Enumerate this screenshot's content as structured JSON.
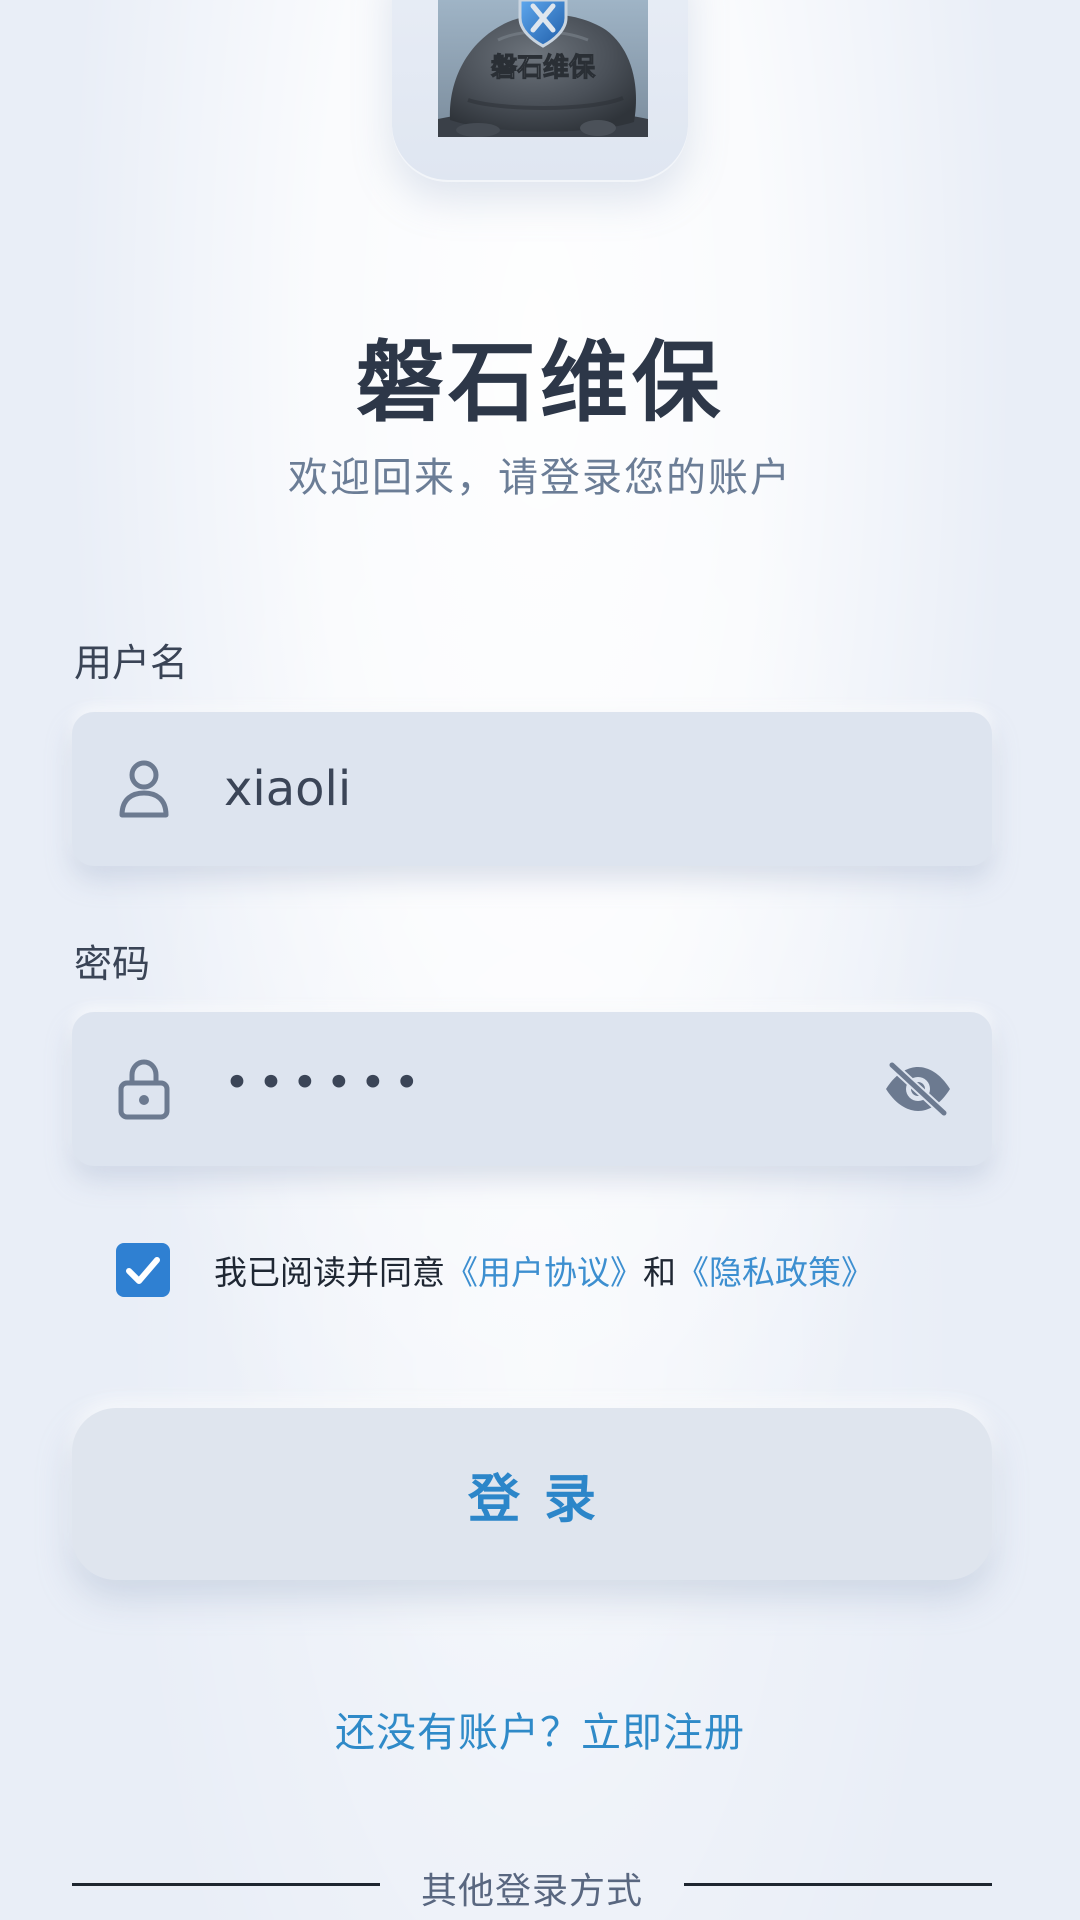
{
  "logo": {
    "image_text": "磐石维保"
  },
  "header": {
    "title": "磐石维保",
    "subtitle": "欢迎回来，请登录您的账户"
  },
  "form": {
    "username": {
      "label": "用户名",
      "value": "xiaoli",
      "icon": "user-icon"
    },
    "password": {
      "label": "密码",
      "value": "••••••",
      "icon": "lock-icon",
      "toggle_icon": "eye-off-icon"
    }
  },
  "agreement": {
    "checked": true,
    "prefix": "我已阅读并同意",
    "user_agreement": "《用户协议》",
    "connector": "和",
    "privacy_policy": "《隐私政策》"
  },
  "login_button": {
    "label": "登录"
  },
  "register": {
    "text": "还没有账户？立即注册"
  },
  "other_login": {
    "label": "其他登录方式"
  },
  "colors": {
    "accent": "#2f80d2",
    "link": "#3d8fd0",
    "background": "#e9eef7",
    "field_bg": "#dde4ef",
    "title": "#2d3748"
  }
}
